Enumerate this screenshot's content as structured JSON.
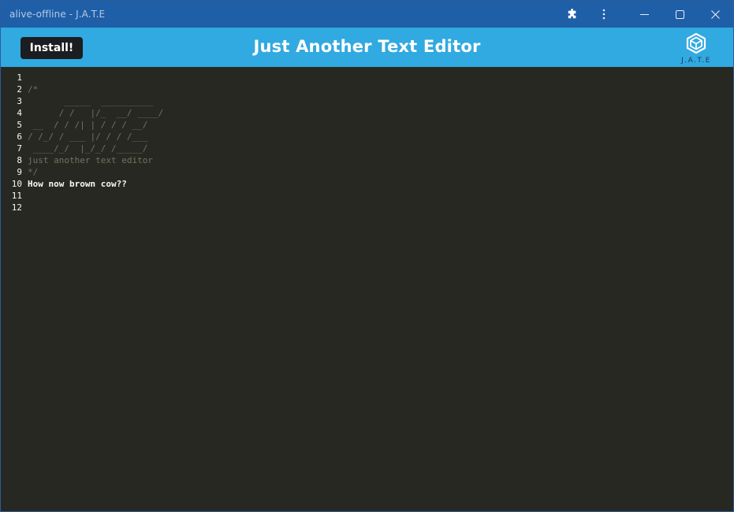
{
  "window": {
    "title": "alive-offline - J.A.T.E"
  },
  "titlebar_icons": [
    "puzzle-icon",
    "more-vertical-icon",
    "minimize-icon",
    "maximize-icon",
    "close-icon"
  ],
  "header": {
    "install_label": "Install!",
    "app_title": "Just Another Text Editor",
    "logo_text": "J.A.T.E"
  },
  "colors": {
    "titlebar": "#1f5fa8",
    "appbar": "#31a9e1",
    "editor_bg": "#272822",
    "comment": "#75715e",
    "text": "#f8f8f2"
  },
  "editor": {
    "line_numbers": [
      "1",
      "2",
      "3",
      "4",
      "5",
      "6",
      "7",
      "8",
      "9",
      "10",
      "11",
      "12"
    ],
    "lines": [
      "",
      "/*",
      "       _____  __________",
      "      / /   |/_  __/ ____/",
      " __  / / /| | / / / __/",
      "/ /_/ / ___ |/ / / /___",
      " ____/_/  |_/_/ /_____/",
      "just another text editor",
      "*/",
      "How now brown cow??",
      "",
      ""
    ]
  }
}
